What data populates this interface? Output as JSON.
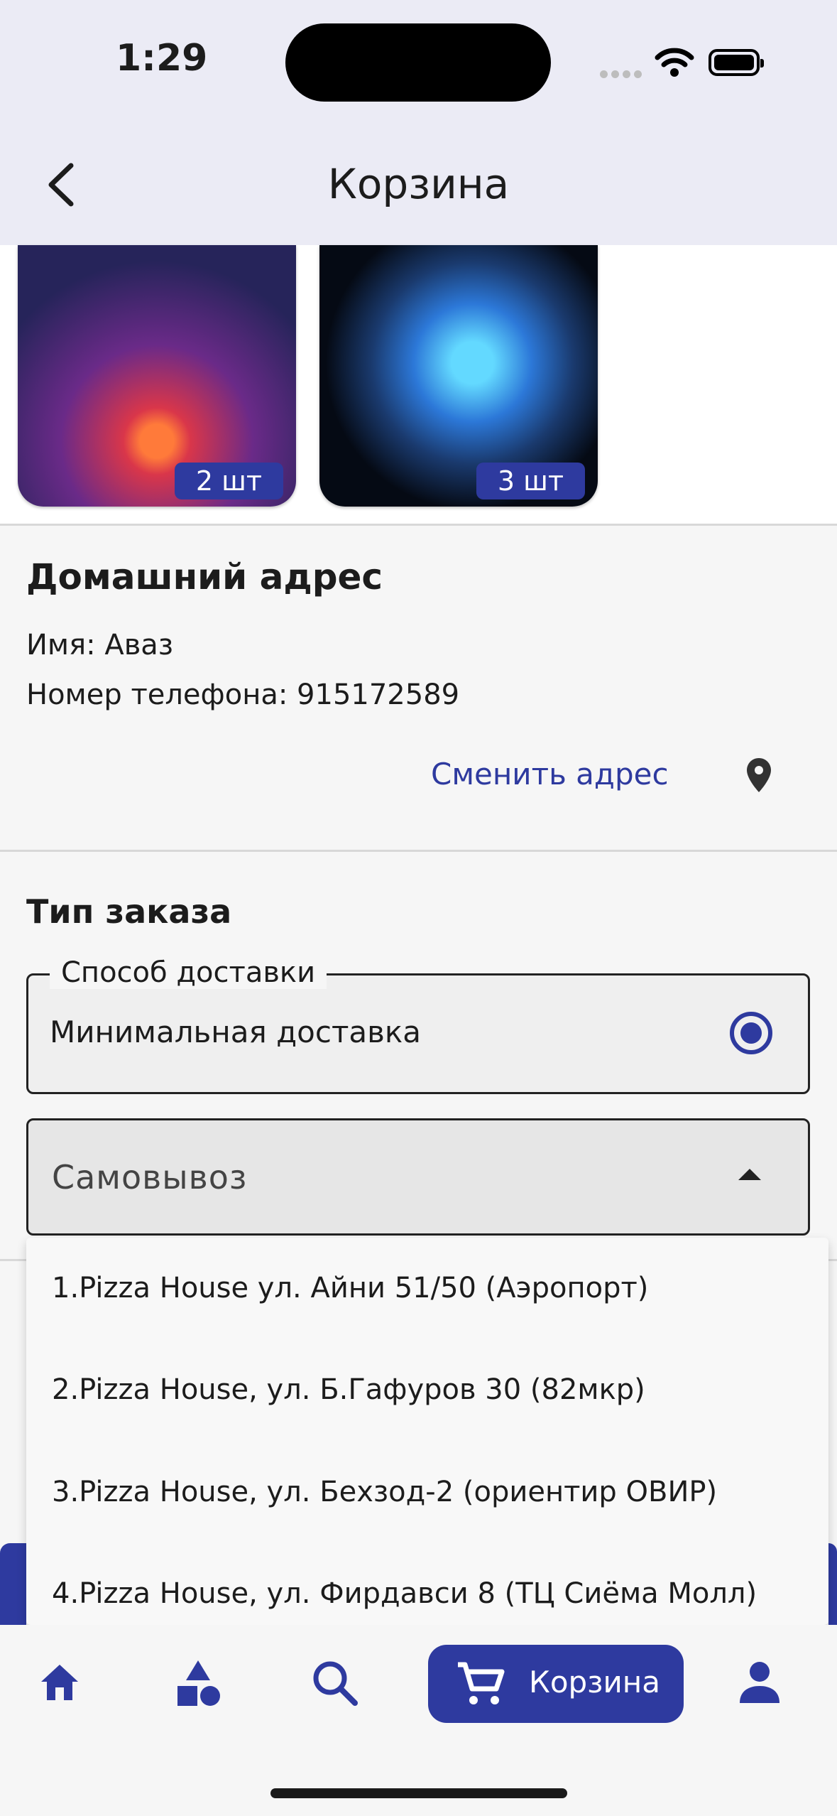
{
  "status": {
    "time": "1:29"
  },
  "header": {
    "title": "Корзина"
  },
  "products": [
    {
      "qty": "2 шт"
    },
    {
      "qty": "3 шт"
    }
  ],
  "address": {
    "title": "Домашний адрес",
    "name": "Имя: Аваз",
    "phone": "Номер телефона: 915172589",
    "change_label": "Сменить адрес"
  },
  "order": {
    "title": "Тип заказа",
    "delivery_legend": "Способ доставки",
    "delivery_value": "Минимальная доставка",
    "select_value": "Самовывоз",
    "options": [
      "1.Pizza House ул. Айни 51/50 (Аэропорт)",
      "2.Pizza House, ул. Б.Гафуров 30 (82мкр)",
      "3.Pizza House, ул. Бехзод-2 (ориентир ОВИР)",
      "4.Pizza House, ул. Фирдавси 8 (ТЦ Сиёма Молл)"
    ]
  },
  "nav": {
    "cart_label": "Корзина"
  },
  "colors": {
    "accent": "#2e3a9f",
    "appbar": "#ebebf5"
  }
}
